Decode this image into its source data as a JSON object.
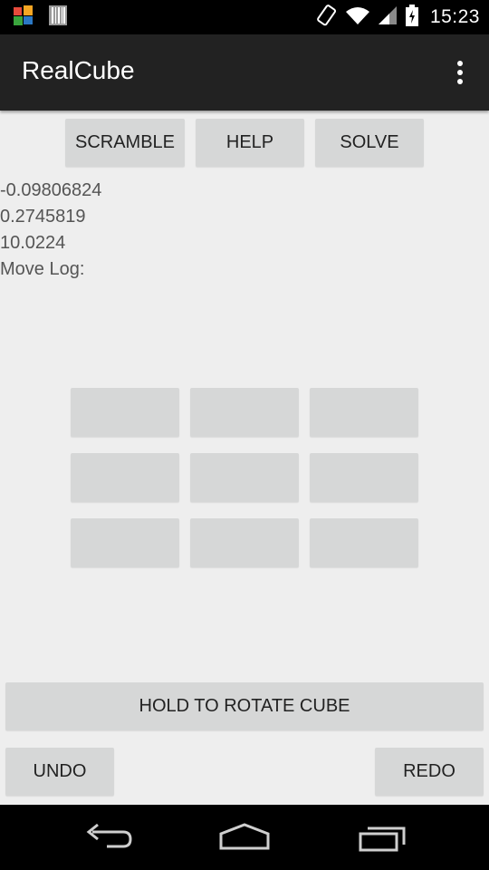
{
  "status_bar": {
    "time": "15:23",
    "left_icons": [
      "avg-antivirus-icon",
      "barcode-icon"
    ],
    "right_icons": [
      "screen-rotation-icon",
      "wifi-icon",
      "cell-signal-icon",
      "battery-icon"
    ]
  },
  "app_bar": {
    "title": "RealCube",
    "overflow_icon": "more-vert-icon"
  },
  "top_buttons": {
    "scramble": "SCRAMBLE",
    "help": "HELP",
    "solve": "SOLVE"
  },
  "sensor_readout": {
    "x": "-0.09806824",
    "y": "0.2745819",
    "z": "10.0224",
    "move_log_label": "Move Log:"
  },
  "cube_face": {
    "cells": [
      "",
      "",
      "",
      "",
      "",
      "",
      "",
      "",
      ""
    ],
    "cell_color": "#d6d7d7"
  },
  "bottom_buttons": {
    "rotate": "HOLD TO ROTATE CUBE",
    "undo": "UNDO",
    "redo": "REDO"
  },
  "nav_bar": {
    "back_icon": "back-icon",
    "home_icon": "home-icon",
    "recents_icon": "recents-icon"
  },
  "colors": {
    "background": "#eeeeee",
    "action_bar": "#222222",
    "button": "#d6d7d7",
    "text": "#222222",
    "readout_text": "#555555"
  }
}
